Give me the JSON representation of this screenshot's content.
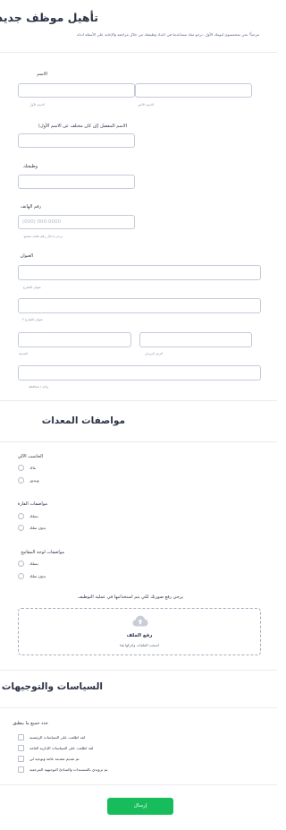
{
  "header": {
    "title": "تأهيل موظف جديد",
    "description": "مرحباً! نحن متحمسون لبومك الأول. نرجو منك مساعدتنا في اعداد وظيفتك من خلال مراجعة والإجابة على الأسئلة ادناه"
  },
  "name": {
    "label": "الاسم",
    "first_sub": "الاسم الأول",
    "last_sub": "الاسم الأخير"
  },
  "preferred_name": {
    "label": "الاسم المفضل (إن كان مختلف عن الاسم الأول)"
  },
  "job": {
    "label": "وظيفتك"
  },
  "phone": {
    "label": "رقم الهاتف",
    "placeholder": "(000) 000-0000",
    "hint": "يرجى إدخال رقم هاتف صحيح"
  },
  "address": {
    "label": "العنوان",
    "street_sub": "عنوان الشارع",
    "street2_sub": "عنوان الشارع ٢",
    "city_sub": "المدينة",
    "postal_sub": "الرمز البريدي",
    "state_sub": "ولاية / محافظة"
  },
  "equipment": {
    "title": "مواصفات المعدات",
    "computer": {
      "label": "الحاسب الآلي",
      "options": [
        "ماك",
        "ويندوز"
      ]
    },
    "mouse": {
      "label": "مواصفات الفارة",
      "options": [
        "بسلك",
        "بدون سلك"
      ]
    },
    "keyboard": {
      "label": "مواصفات لوحة المفاتيح",
      "options": [
        "بسلك",
        "بدون سلك"
      ]
    }
  },
  "upload": {
    "label": "يرجى رفع صورتك لكي يتم استخدامها في عملية التوظيف",
    "title": "رفع الملف",
    "subtitle": "اسحب الملفات واتركها هنا"
  },
  "policies": {
    "title": "السياسات والتوجيهات",
    "label": "حدد جميع ما ينطبق",
    "options": [
      "لقد اطلعت على السياسات الرئيسية",
      "لقد اطلعت على السياسات الإدارية العامة",
      "تم تقديم مقدمة عامة وتوجيه لي",
      "تم تزويدي بالمستندات والمبادئ التوجيهية المرجعية"
    ]
  },
  "submit": {
    "label": "إرسال"
  },
  "colors": {
    "accent": "#18bd5b",
    "field_border": "#c3cad8",
    "text": "#2c3345"
  },
  "icons": {
    "upload": "cloud-upload-icon"
  }
}
